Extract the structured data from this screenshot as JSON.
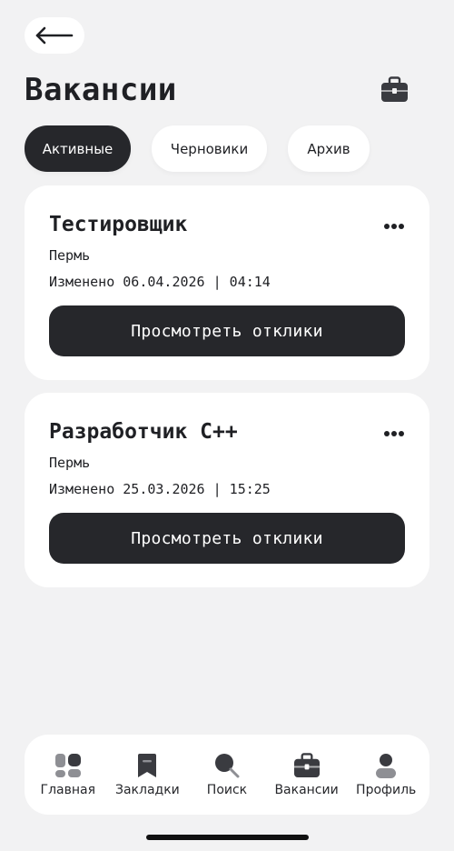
{
  "header": {
    "title": "Вакансии"
  },
  "tabs": [
    {
      "label": "Активные",
      "active": true
    },
    {
      "label": "Черновики",
      "active": false
    },
    {
      "label": "Архив",
      "active": false
    }
  ],
  "vacancies": [
    {
      "title": "Тестировщик",
      "city": "Пермь",
      "updated": "Изменено 06.04.2026 | 04:14",
      "action_label": "Просмотреть отклики"
    },
    {
      "title": "Разработчик С++",
      "city": "Пермь",
      "updated": "Изменено 25.03.2026 | 15:25",
      "action_label": "Просмотреть отклики"
    }
  ],
  "bottom_nav": [
    {
      "label": "Главная",
      "icon": "home-icon"
    },
    {
      "label": "Закладки",
      "icon": "bookmark-icon"
    },
    {
      "label": "Поиск",
      "icon": "search-icon"
    },
    {
      "label": "Вакансии",
      "icon": "briefcase-icon"
    },
    {
      "label": "Профиль",
      "icon": "profile-icon"
    }
  ],
  "colors": {
    "background": "#f2f2f3",
    "accent_dark": "#26272b",
    "surface": "#ffffff"
  }
}
